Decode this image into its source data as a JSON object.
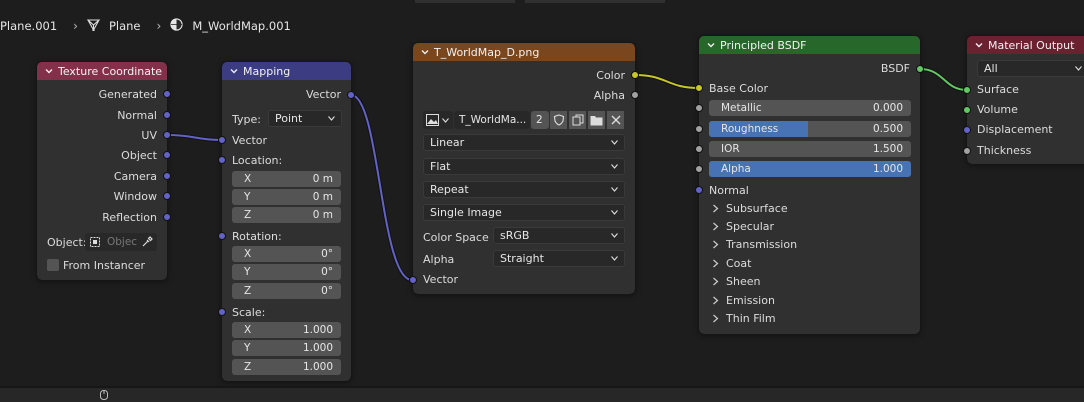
{
  "breadcrumb": {
    "object": "Plane.001",
    "mesh": "Plane",
    "material": "M_WorldMap.001"
  },
  "nodes": {
    "texture_coordinate": {
      "title": "Texture Coordinate",
      "outputs": [
        "Generated",
        "Normal",
        "UV",
        "Object",
        "Camera",
        "Window",
        "Reflection"
      ],
      "object_label": "Object:",
      "object_placeholder": "Objec",
      "from_instancer": "From Instancer",
      "header_color": "#83314a"
    },
    "mapping": {
      "title": "Mapping",
      "output": "Vector",
      "type_label": "Type:",
      "type_value": "Point",
      "vector_input": "Vector",
      "location_label": "Location:",
      "location": [
        {
          "axis": "X",
          "value": "0 m"
        },
        {
          "axis": "Y",
          "value": "0 m"
        },
        {
          "axis": "Z",
          "value": "0 m"
        }
      ],
      "rotation_label": "Rotation:",
      "rotation": [
        {
          "axis": "X",
          "value": "0°"
        },
        {
          "axis": "Y",
          "value": "0°"
        },
        {
          "axis": "Z",
          "value": "0°"
        }
      ],
      "scale_label": "Scale:",
      "scale": [
        {
          "axis": "X",
          "value": "1.000"
        },
        {
          "axis": "Y",
          "value": "1.000"
        },
        {
          "axis": "Z",
          "value": "1.000"
        }
      ],
      "header_color": "#3c3c83"
    },
    "image_texture": {
      "title": "T_WorldMap_D.png",
      "outputs": [
        "Color",
        "Alpha"
      ],
      "image_name": "T_WorldMa...",
      "user_count": "2",
      "interpolation": "Linear",
      "projection": "Flat",
      "extension": "Repeat",
      "source": "Single Image",
      "color_space_label": "Color Space",
      "color_space": "sRGB",
      "alpha_label": "Alpha",
      "alpha_mode": "Straight",
      "vector_input": "Vector",
      "header_color": "#79461d"
    },
    "principled": {
      "title": "Principled BSDF",
      "output": "BSDF",
      "base_color": "Base Color",
      "metallic": {
        "label": "Metallic",
        "value": "0.000",
        "fraction": 0
      },
      "roughness": {
        "label": "Roughness",
        "value": "0.500",
        "fraction": 0.5
      },
      "ior": {
        "label": "IOR",
        "value": "1.500",
        "fraction": 0
      },
      "alpha": {
        "label": "Alpha",
        "value": "1.000",
        "fraction": 1
      },
      "normal": "Normal",
      "panels": [
        "Subsurface",
        "Specular",
        "Transmission",
        "Coat",
        "Sheen",
        "Emission",
        "Thin Film"
      ],
      "header_color": "#28672a"
    },
    "material_output": {
      "title": "Material Output",
      "target": "All",
      "inputs": [
        "Surface",
        "Volume",
        "Displacement",
        "Thickness"
      ],
      "header_color": "#6b2130"
    }
  },
  "colors": {
    "vector_socket": "#6363c7",
    "color_socket": "#c7c729",
    "shader_socket": "#63c763",
    "value_socket": "#a1a1a1",
    "slider_fill": "#4772b3"
  }
}
